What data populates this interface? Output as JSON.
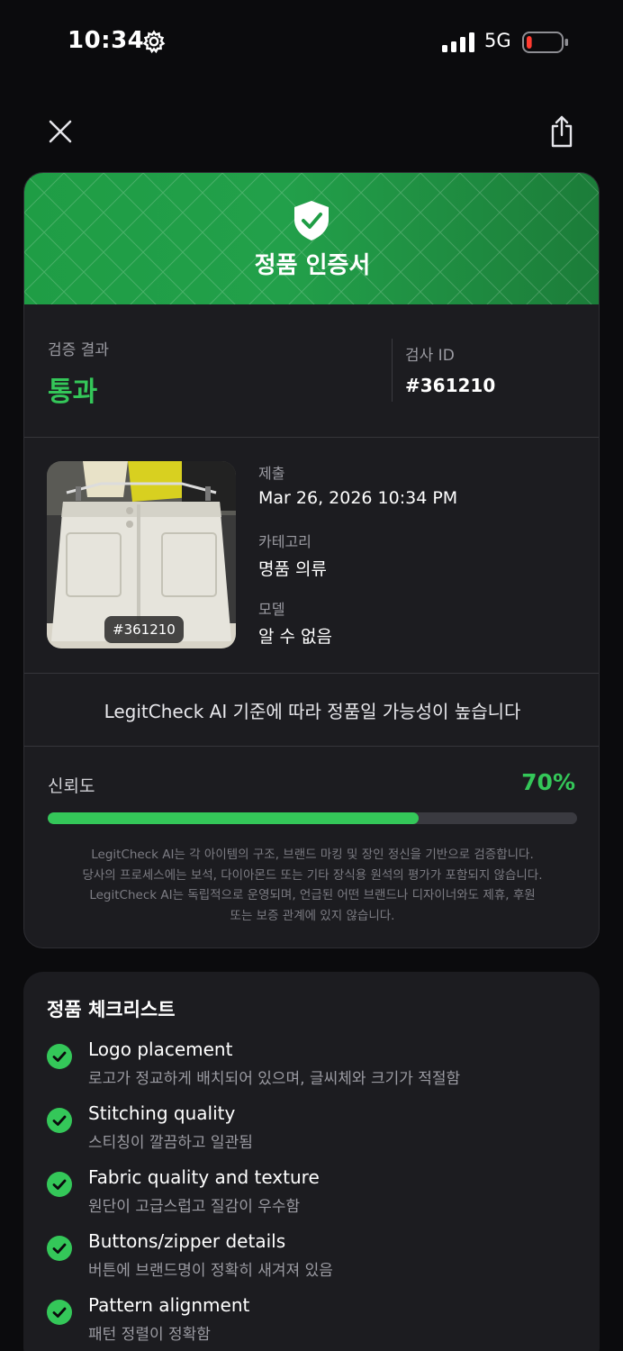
{
  "status_bar": {
    "time": "10:34",
    "network": "5G",
    "battery_level": 0.1
  },
  "nav": {
    "close_icon": "close-icon",
    "share_icon": "share-icon"
  },
  "certificate": {
    "title": "정품 인증서",
    "result_label": "검증 결과",
    "result_value": "통과",
    "check_id_label": "검사 ID",
    "check_id_value": "#361210",
    "photo_tag": "#361210",
    "submitted_label": "제출",
    "submitted_value": "Mar 26, 2026 10:34 PM",
    "category_label": "카테고리",
    "category_value": "명품 의류",
    "model_label": "모델",
    "model_value": "알 수 없음",
    "statement": "LegitCheck AI 기준에 따라 정품일 가능성이 높습니다",
    "confidence_label": "신뢰도",
    "confidence_text": "70%",
    "confidence_value": 0.7,
    "disclaimer_lines": [
      "LegitCheck AI는 각 아이템의 구조, 브랜드 마킹 및 장인 정신을 기반으로 검증합니다.",
      "당사의 프로세스에는 보석, 다이아몬드 또는 기타 장식용 원석의 평가가 포함되지 않습니다.",
      "LegitCheck AI는 독립적으로 운영되며, 언급된 어떤 브랜드나 디자이너와도 제휴, 후원",
      "또는 보증 관계에 있지 않습니다."
    ]
  },
  "checklist": {
    "title": "정품 체크리스트",
    "items": [
      {
        "title": "Logo placement",
        "desc": "로고가 정교하게 배치되어 있으며, 글씨체와 크기가 적절함"
      },
      {
        "title": "Stitching quality",
        "desc": "스티칭이 깔끔하고 일관됨"
      },
      {
        "title": "Fabric quality and texture",
        "desc": "원단이 고급스럽고 질감이 우수함"
      },
      {
        "title": "Buttons/zipper details",
        "desc": "버튼에 브랜드명이 정확히 새겨져 있음"
      },
      {
        "title": "Pattern alignment",
        "desc": "패턴 정렬이 정확함"
      }
    ]
  },
  "colors": {
    "accent_green": "#34c759",
    "header_green": "#22a04a",
    "card_bg": "#1c1c20",
    "page_bg": "#0b0b0d"
  }
}
